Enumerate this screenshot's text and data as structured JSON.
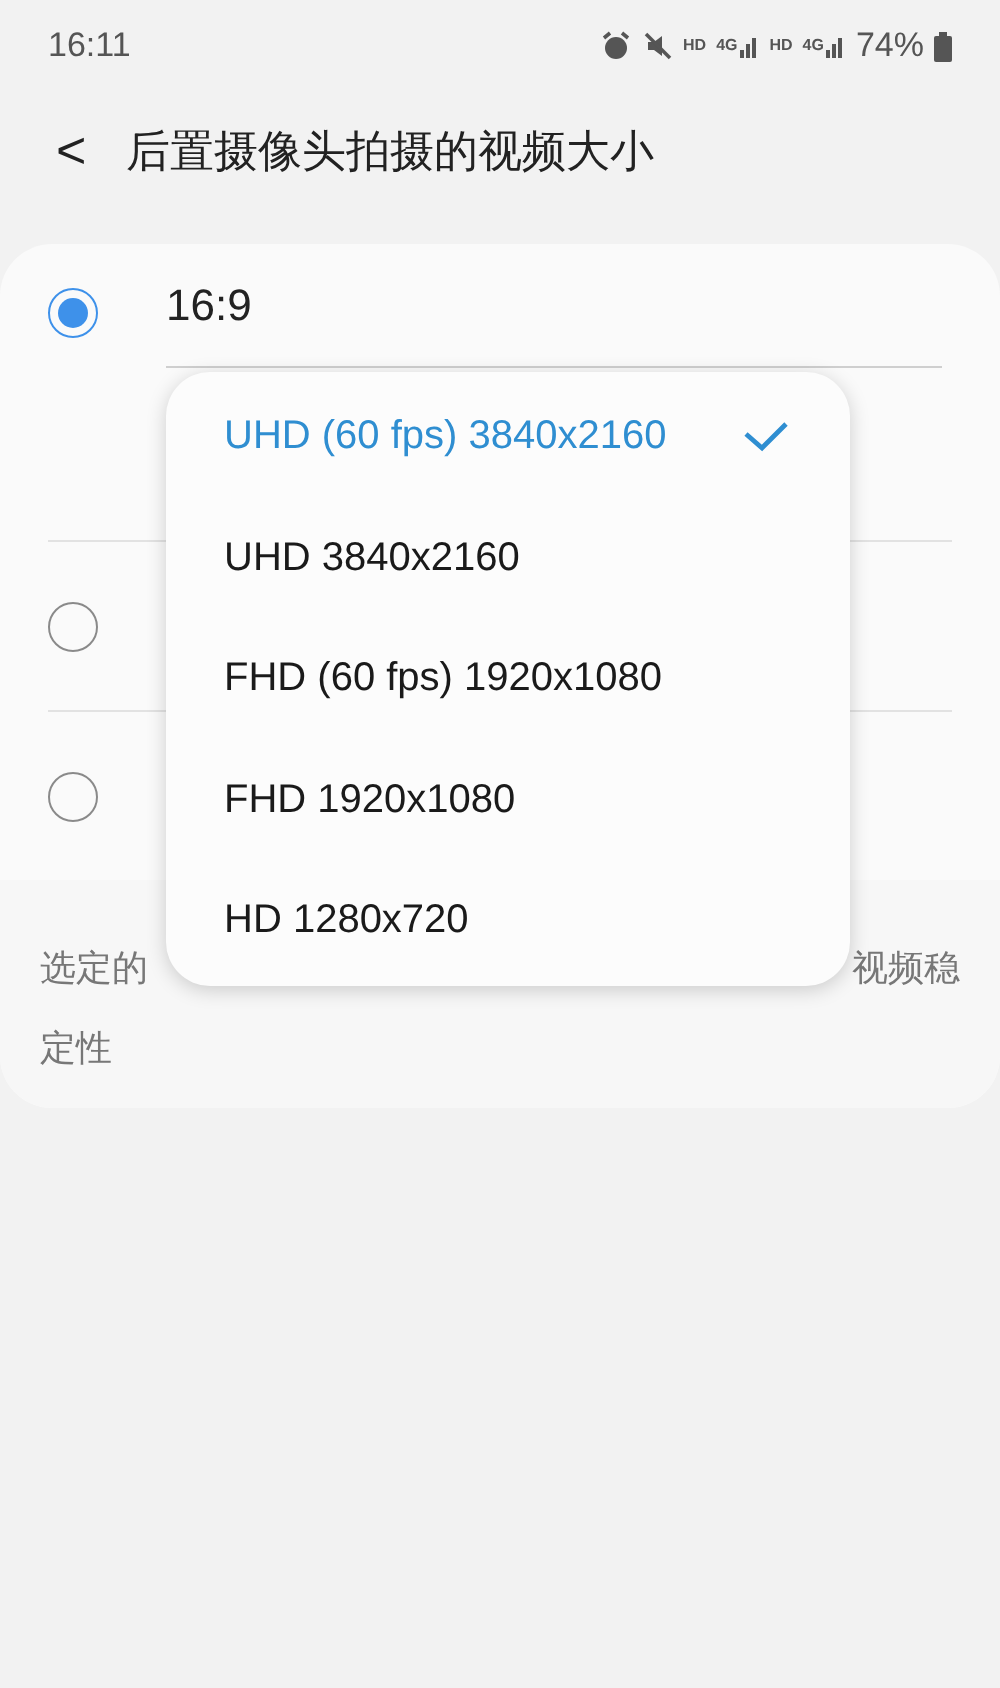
{
  "status_bar": {
    "time": "16:11",
    "network": [
      "HD",
      "4G",
      "HD",
      "4G"
    ],
    "battery": "74%"
  },
  "header": {
    "back": "<",
    "title": "后置摄像头拍摄的视频大小"
  },
  "options": [
    {
      "label": "16:9",
      "selected": true
    },
    {
      "selected": false
    },
    {
      "selected": false
    }
  ],
  "note": {
    "line_1_left": "选定的",
    "line_1_right": "视频稳",
    "line_2": "定性"
  },
  "menu": [
    {
      "label": "UHD (60 fps) 3840x2160",
      "selected": true
    },
    {
      "label": "UHD 3840x2160",
      "selected": false
    },
    {
      "label": "FHD (60 fps) 1920x1080",
      "selected": false
    },
    {
      "label": "FHD 1920x1080",
      "selected": false
    },
    {
      "label": "HD 1280x720",
      "selected": false
    }
  ]
}
